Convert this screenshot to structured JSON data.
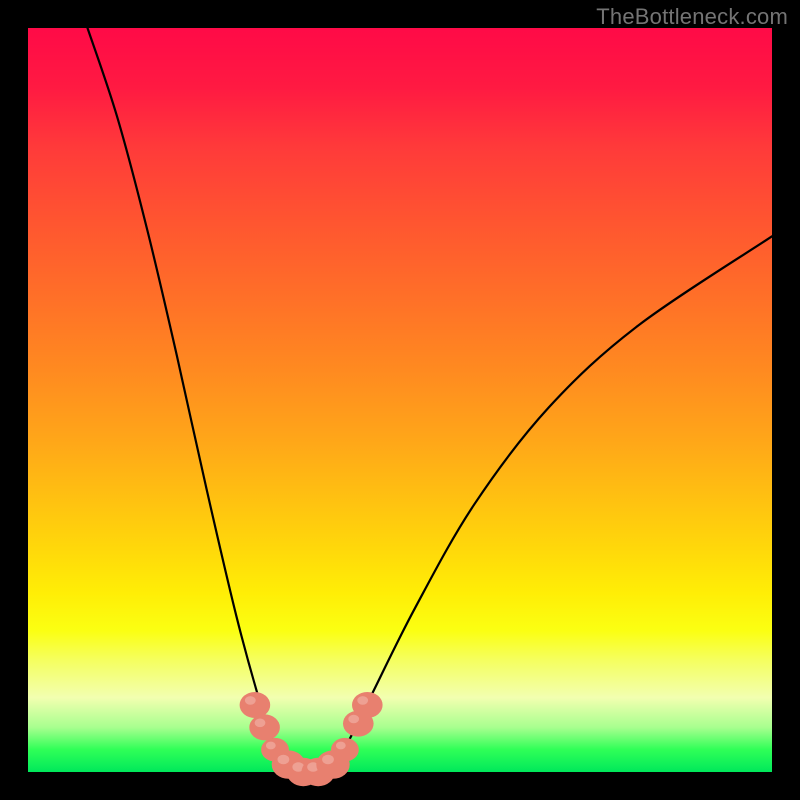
{
  "watermark": "TheBottleneck.com",
  "colors": {
    "frame": "#000000",
    "curve": "#000000",
    "marker": "#e8806f"
  },
  "chart_data": {
    "type": "line",
    "title": "",
    "xlabel": "",
    "ylabel": "",
    "x_range": [
      0,
      100
    ],
    "y_range": [
      0,
      100
    ],
    "description": "Single V-shaped bottleneck curve over a red→green vertical gradient. Minimum (best) sits near the green band at bottom; both arms rise steeply, left arm steeper than right.",
    "gradient_stops": [
      {
        "pct": 0,
        "color": "#ff0a47"
      },
      {
        "pct": 50,
        "color": "#ff8a20"
      },
      {
        "pct": 80,
        "color": "#fbff12"
      },
      {
        "pct": 97,
        "color": "#2fff57"
      },
      {
        "pct": 100,
        "color": "#00e85b"
      }
    ],
    "series": [
      {
        "name": "bottleneck-curve",
        "points": [
          {
            "x": 8,
            "y": 100
          },
          {
            "x": 12,
            "y": 88
          },
          {
            "x": 16,
            "y": 73
          },
          {
            "x": 20,
            "y": 56
          },
          {
            "x": 24,
            "y": 38
          },
          {
            "x": 28,
            "y": 21
          },
          {
            "x": 31,
            "y": 10
          },
          {
            "x": 33,
            "y": 4
          },
          {
            "x": 35,
            "y": 1
          },
          {
            "x": 38,
            "y": 0
          },
          {
            "x": 41,
            "y": 1
          },
          {
            "x": 43,
            "y": 4
          },
          {
            "x": 46,
            "y": 10
          },
          {
            "x": 52,
            "y": 22
          },
          {
            "x": 60,
            "y": 36
          },
          {
            "x": 70,
            "y": 49
          },
          {
            "x": 82,
            "y": 60
          },
          {
            "x": 100,
            "y": 72
          }
        ]
      }
    ],
    "markers": [
      {
        "x": 30.5,
        "y": 9,
        "r": 1.6
      },
      {
        "x": 31.8,
        "y": 6,
        "r": 1.6
      },
      {
        "x": 33.2,
        "y": 3,
        "r": 1.4
      },
      {
        "x": 35.0,
        "y": 1,
        "r": 1.8
      },
      {
        "x": 37.0,
        "y": 0,
        "r": 1.8
      },
      {
        "x": 39.0,
        "y": 0,
        "r": 1.8
      },
      {
        "x": 41.0,
        "y": 1,
        "r": 1.8
      },
      {
        "x": 42.6,
        "y": 3,
        "r": 1.4
      },
      {
        "x": 44.4,
        "y": 6.5,
        "r": 1.6
      },
      {
        "x": 45.6,
        "y": 9,
        "r": 1.6
      }
    ]
  }
}
